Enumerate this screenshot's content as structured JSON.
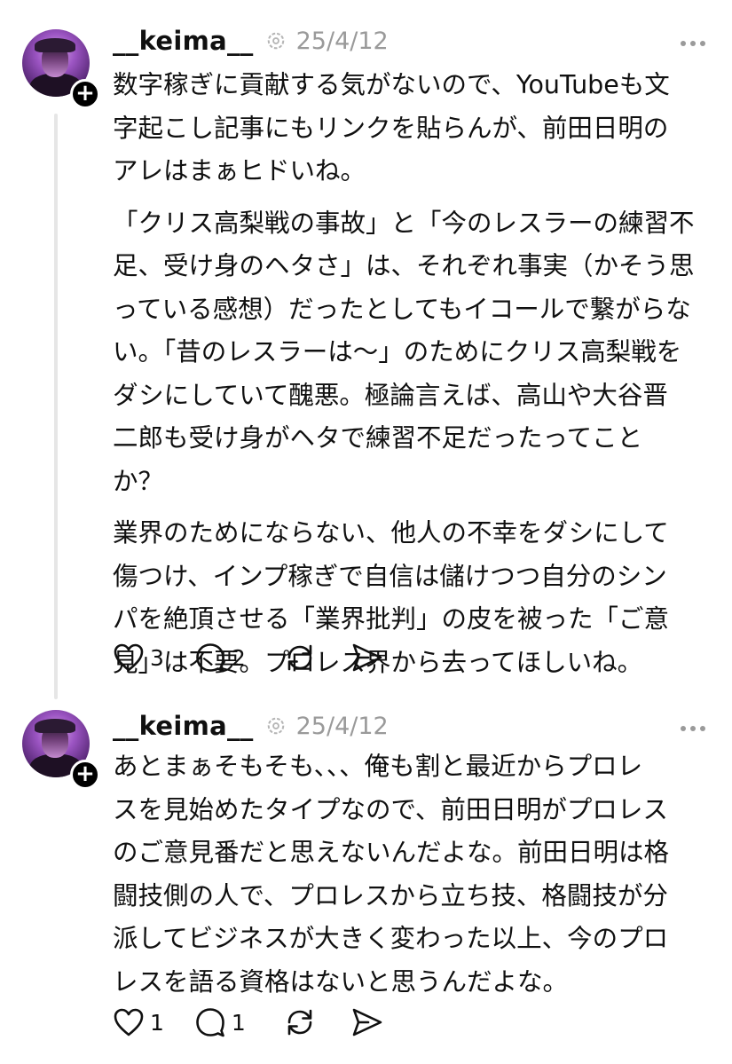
{
  "posts": [
    {
      "username": "__keima__",
      "date": "25/4/12",
      "paragraphs": [
        "数字稼ぎに貢献する気がないので、YouTubeも文\n字起こし記事にもリンクを貼らんが、前田日明の\nアレはまぁヒドいね。",
        "「クリス高梨戦の事故」と「今のレスラーの練習不\n足、受け身のヘタさ」は、それぞれ事実（かそう思\nっている感想）だったとしてもイコールで繋がらな\nい。「昔のレスラーは〜」のためにクリス高梨戦を\nダシにしていて醜悪。極論言えば、高山や大谷晋\n二郎も受け身がヘタで練習不足だったってこと\nか？",
        "業界のためにならない、他人の不幸をダシにして\n傷つけ、インプ稼ぎで自信は儲けつつ自分のシン\nパを絶頂させる「業界批判」の皮を被った「ご意\n見」は不要。プロレス界から去ってほしいね。"
      ],
      "likes": "3",
      "replies": "2",
      "icons": [
        "heart-icon",
        "comment-icon",
        "repost-icon",
        "share-icon"
      ]
    },
    {
      "username": "__keima__",
      "date": "25/4/12",
      "paragraphs": [
        "あとまぁそもそも、、、俺も割と最近からプロレ\nスを見始めたタイプなので、前田日明がプロレス\nのご意見番だと思えないんだよな。前田日明は格\n闘技側の人で、プロレスから立ち技、格闘技が分\n派してビジネスが大きく変わった以上、今のプロ\nレスを語る資格はないと思うんだよな。"
      ],
      "likes": "1",
      "replies": "1",
      "icons": [
        "heart-icon",
        "comment-icon",
        "repost-icon",
        "share-icon"
      ]
    }
  ],
  "colors": {
    "text": "#101010",
    "muted": "#9a9a9a",
    "thread_line": "#e6e6e6",
    "background": "#ffffff"
  }
}
